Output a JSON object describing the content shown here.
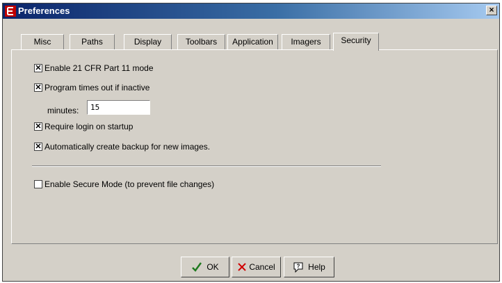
{
  "window": {
    "title": "Preferences",
    "close_label": "×"
  },
  "tabs": [
    {
      "label": "Misc"
    },
    {
      "label": "Paths"
    },
    {
      "label": "Display"
    },
    {
      "label": "Toolbars"
    },
    {
      "label": "Application"
    },
    {
      "label": "Imagers"
    },
    {
      "label": "Security",
      "active": true
    }
  ],
  "security": {
    "enable_cfr_label": "Enable 21 CFR Part 11 mode",
    "enable_cfr_checked": true,
    "timeout_label": "Program times out if inactive",
    "timeout_checked": true,
    "minutes_label": "minutes:",
    "minutes_value": "15",
    "require_login_label": "Require login on startup",
    "require_login_checked": true,
    "auto_backup_label": "Automatically create backup for new images.",
    "auto_backup_checked": true,
    "secure_mode_label": "Enable Secure Mode (to prevent file changes)",
    "secure_mode_checked": false
  },
  "buttons": {
    "ok": "OK",
    "cancel": "Cancel",
    "help": "Help"
  }
}
